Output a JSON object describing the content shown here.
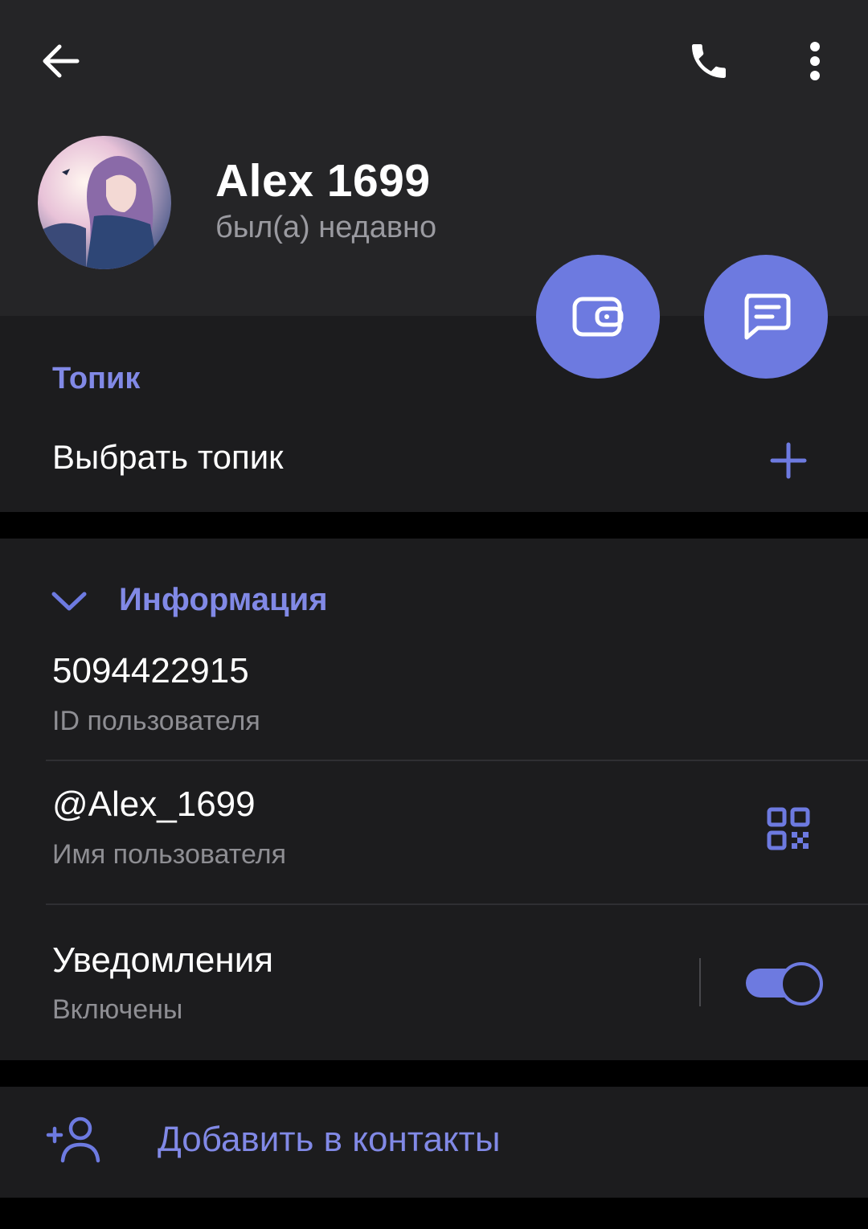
{
  "profile": {
    "name": "Alex 1699",
    "status": "был(а) недавно"
  },
  "topic": {
    "heading": "Топик",
    "select_label": "Выбрать топик"
  },
  "info": {
    "heading": "Информация",
    "user_id": "5094422915",
    "user_id_label": "ID пользователя",
    "username": "@Alex_1699",
    "username_label": "Имя пользователя",
    "notifications_title": "Уведомления",
    "notifications_state": "Включены",
    "notifications_enabled": true
  },
  "actions": {
    "add_contact": "Добавить в контакты"
  },
  "icons": {
    "back": "arrow-left-icon",
    "call": "phone-icon",
    "more": "more-vertical-icon",
    "wallet": "wallet-icon",
    "message": "message-icon",
    "plus": "plus-icon",
    "chevron": "chevron-down-icon",
    "qr": "qr-code-icon",
    "add_contact": "add-user-icon"
  },
  "colors": {
    "accent": "#6d7ae0",
    "accent_text": "#8189e6",
    "header_bg": "#252527",
    "section_bg": "#1c1c1e"
  }
}
